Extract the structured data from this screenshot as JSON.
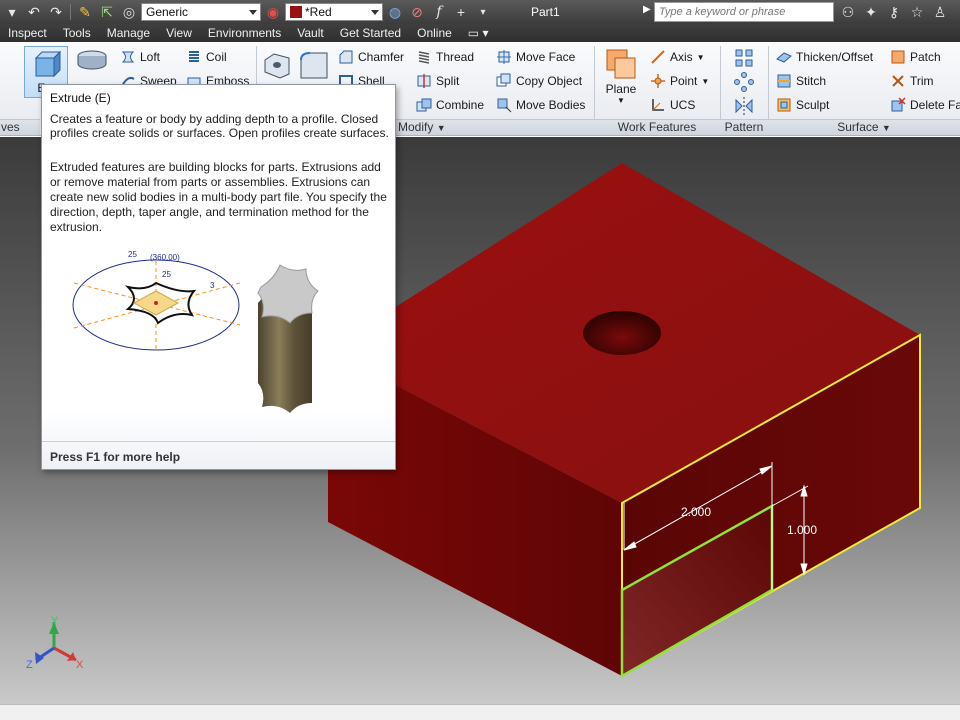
{
  "qat": {
    "material": "Generic",
    "appearance": "*Red",
    "title": "Part1",
    "search_placeholder": "Type a keyword or phrase"
  },
  "tabs": [
    "Inspect",
    "Tools",
    "Manage",
    "View",
    "Environments",
    "Vault",
    "Get Started",
    "Online"
  ],
  "ribbon": {
    "create": {
      "extrude_short": "Ext",
      "loft": "Loft",
      "coil": "Coil",
      "sweep": "Sweep",
      "emboss": "Emboss",
      "panel_tail": "ves"
    },
    "modify": {
      "chamfer": "Chamfer",
      "shell": "Shell",
      "thread": "Thread",
      "split": "Split",
      "combine": "Combine",
      "move_face": "Move Face",
      "copy_object": "Copy Object",
      "move_bodies": "Move Bodies",
      "label": "Modify"
    },
    "work_features": {
      "plane": "Plane",
      "axis": "Axis",
      "point": "Point",
      "ucs": "UCS",
      "label": "Work Features"
    },
    "pattern": {
      "label": "Pattern"
    },
    "surface": {
      "thicken": "Thicken/Offset",
      "stitch": "Stitch",
      "sculpt": "Sculpt",
      "patch": "Patch",
      "trim": "Trim",
      "delete_face": "Delete Fa",
      "label": "Surface"
    }
  },
  "tooltip": {
    "title": "Extrude (E)",
    "body1": "Creates a feature or body by adding depth to a profile. Closed profiles create solids or surfaces. Open profiles create surfaces.",
    "body2": "Extruded features are building blocks for parts. Extrusions add or remove material from parts or assemblies. Extrusions can create new solid bodies in a multi-body part file. You specify the direction, depth, taper angle, and termination method for the extrusion.",
    "sketch_dims": [
      "25",
      "(360.00)",
      "25",
      "3"
    ],
    "footer": "Press F1 for more help"
  },
  "model": {
    "body_color": "#8f0e0e",
    "dim_width": "2.000",
    "dim_height": "1.000",
    "sketch_line_color": "#f0ea3a",
    "profile_color": "#8fe23a"
  },
  "triad": {
    "x": "X",
    "y": "Y",
    "z": "Z"
  }
}
